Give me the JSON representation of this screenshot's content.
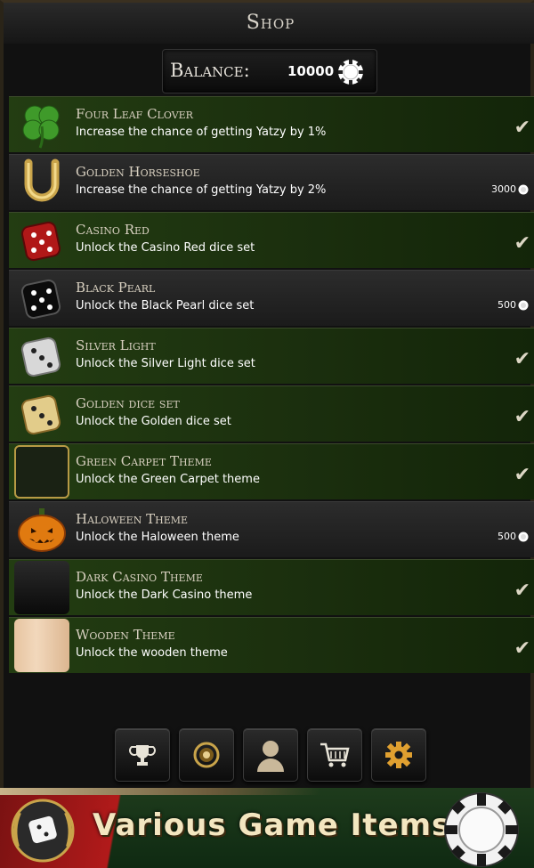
{
  "header": {
    "title": "Shop"
  },
  "balance": {
    "label": "Balance:",
    "value": "10000",
    "chip_icon": "poker-chip-icon"
  },
  "items": [
    {
      "name": "Four Leaf Clover",
      "description": "Increase the chance of getting Yatzy by 1%",
      "owned": true,
      "price": "",
      "icon": "clover-icon"
    },
    {
      "name": "Golden Horseshoe",
      "description": "Increase the chance of getting Yatzy by 2%",
      "owned": false,
      "price": "3000",
      "icon": "horseshoe-icon"
    },
    {
      "name": "Casino Red",
      "description": "Unlock the Casino Red dice set",
      "owned": true,
      "price": "",
      "icon": "red-dice-icon"
    },
    {
      "name": "Black Pearl",
      "description": "Unlock the Black Pearl dice set",
      "owned": false,
      "price": "500",
      "icon": "black-dice-icon"
    },
    {
      "name": "Silver Light",
      "description": "Unlock the Silver Light dice set",
      "owned": true,
      "price": "",
      "icon": "silver-dice-icon"
    },
    {
      "name": "Golden dice set",
      "description": "Unlock the Golden dice set",
      "owned": true,
      "price": "",
      "icon": "golden-dice-icon"
    },
    {
      "name": "Green Carpet Theme",
      "description": "Unlock the Green Carpet theme",
      "owned": true,
      "price": "",
      "icon": "green-carpet-swatch-icon"
    },
    {
      "name": "Haloween Theme",
      "description": "Unlock the Haloween theme",
      "owned": false,
      "price": "500",
      "icon": "pumpkin-icon"
    },
    {
      "name": "Dark Casino Theme",
      "description": "Unlock the Dark Casino theme",
      "owned": true,
      "price": "",
      "icon": "dark-casino-swatch-icon"
    },
    {
      "name": "Wooden Theme",
      "description": "Unlock the wooden theme",
      "owned": true,
      "price": "",
      "icon": "wooden-swatch-icon"
    }
  ],
  "nav": [
    {
      "name": "trophy-icon"
    },
    {
      "name": "laurel-coin-icon"
    },
    {
      "name": "profile-icon"
    },
    {
      "name": "cart-icon"
    },
    {
      "name": "gear-icon"
    }
  ],
  "banner": {
    "text": "Various Game Items"
  },
  "colors": {
    "owned_bg": "#233d12",
    "locked_bg": "#2a2a2a",
    "title_text": "#d8d0c0",
    "check": "#dcd6c4"
  }
}
